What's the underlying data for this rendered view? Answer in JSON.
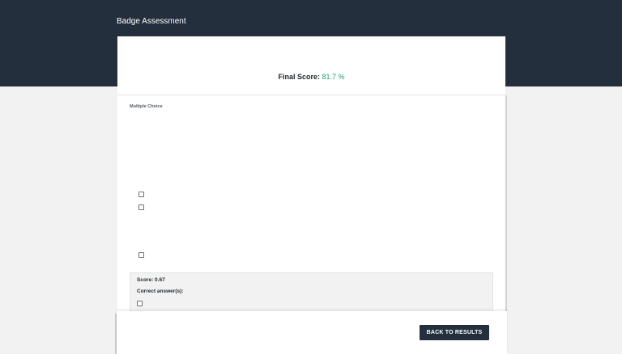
{
  "app": {
    "title": "Badge Assessment"
  },
  "score_card": {
    "label": "Final Score:",
    "value": "81.7 %"
  },
  "question": {
    "section_label": "Multiple Choice",
    "option_count_visible": 3
  },
  "feedback": {
    "score_text": "Score: 0.67",
    "correct_label": "Correct answer(s):"
  },
  "footer": {
    "back_button_label": "BACK TO RESULTS"
  },
  "colors": {
    "header": "#242f3e",
    "accent_score": "#1e9e6a",
    "page_bg": "#f1f2f1"
  }
}
